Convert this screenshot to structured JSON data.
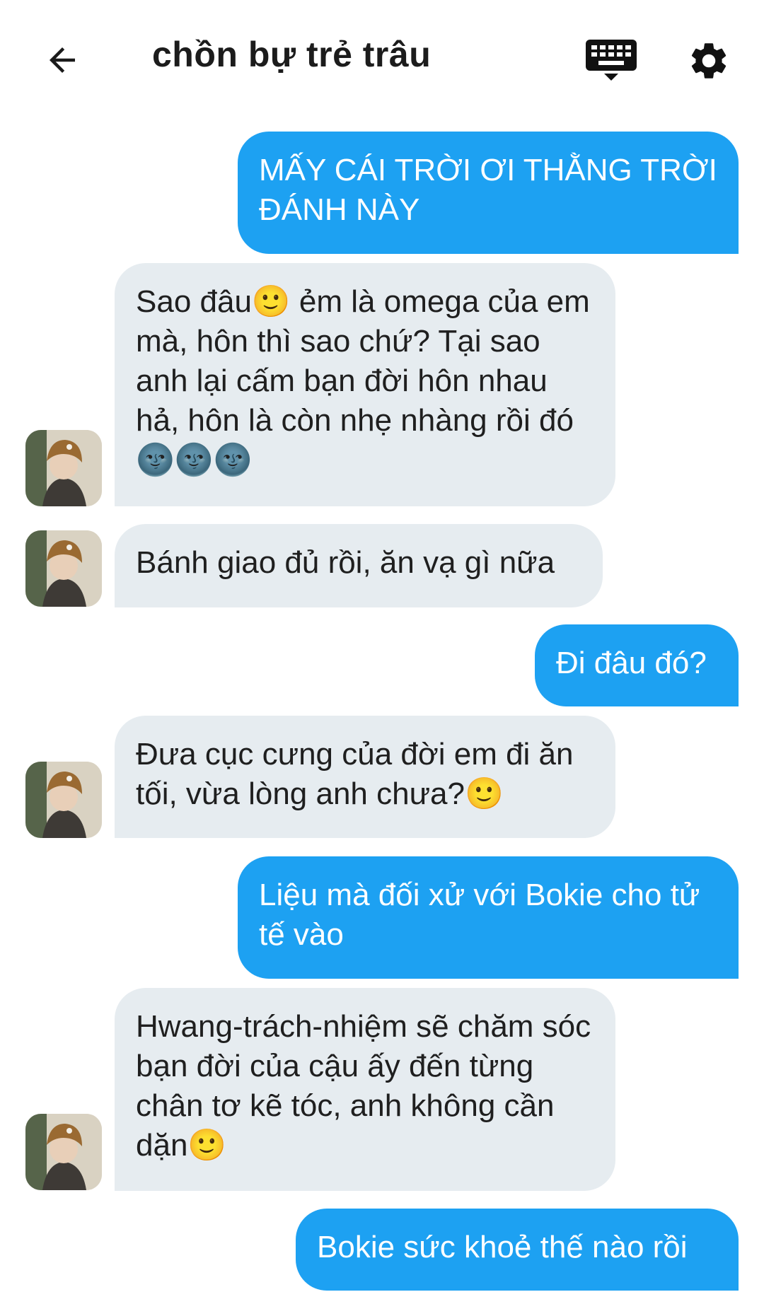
{
  "header": {
    "back_icon": "arrow-left-icon",
    "title": "chồn bự trẻ trâu",
    "keyboard_icon": "keyboard-icon",
    "settings_icon": "gear-icon"
  },
  "colors": {
    "outgoing_bubble": "#1da1f2",
    "incoming_bubble": "#e6ecf0",
    "outgoing_text": "#ffffff",
    "incoming_text": "#1f1f1f"
  },
  "messages": [
    {
      "direction": "outgoing",
      "text": "MẤY CÁI TRỜI ƠI THẰNG TRỜI ĐÁNH NÀY"
    },
    {
      "direction": "incoming",
      "text": "Sao đâu🙂 ẻm là omega của em mà, hôn thì sao chứ? Tại sao anh lại cấm bạn đời hôn nhau hả, hôn là còn nhẹ nhàng rồi đó🌚🌚🌚"
    },
    {
      "direction": "incoming",
      "text": "Bánh giao đủ rồi, ăn vạ gì nữa"
    },
    {
      "direction": "outgoing",
      "text": "Đi đâu đó?"
    },
    {
      "direction": "incoming",
      "text": "Đưa cục cưng của đời em đi ăn tối, vừa lòng anh chưa?🙂"
    },
    {
      "direction": "outgoing",
      "text": "Liệu mà đối xử với Bokie cho tử tế vào"
    },
    {
      "direction": "incoming",
      "text": "Hwang-trách-nhiệm sẽ chăm sóc bạn đời của cậu ấy đến từng chân tơ kẽ tóc, anh không cần dặn🙂"
    },
    {
      "direction": "outgoing",
      "text": "Bokie sức khoẻ thế nào rồi"
    }
  ]
}
